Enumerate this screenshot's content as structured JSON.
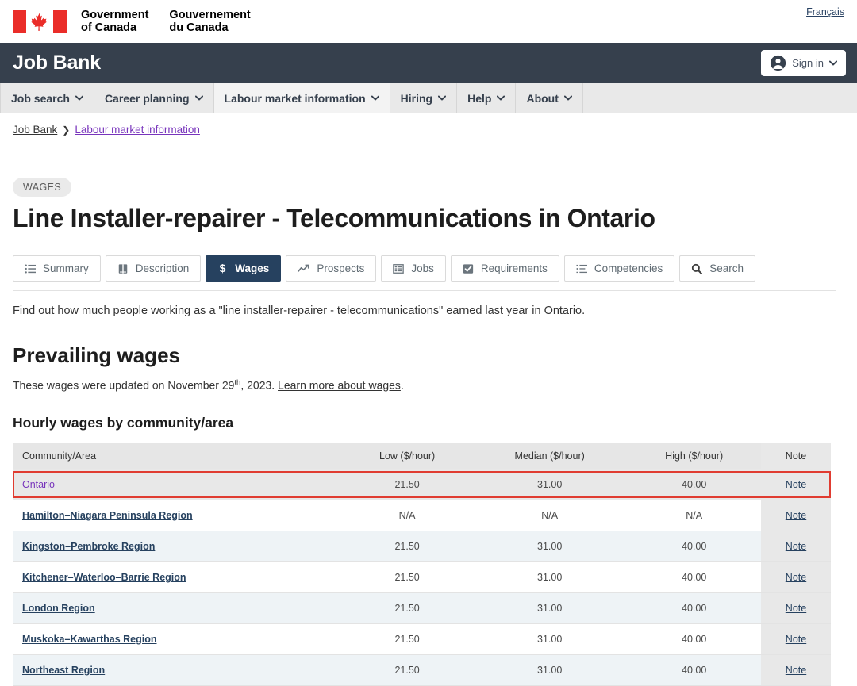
{
  "gov_band": {
    "wordmark_en_line1": "Government",
    "wordmark_en_line2": "of Canada",
    "wordmark_fr_line1": "Gouvernement",
    "wordmark_fr_line2": "du Canada",
    "language_toggle": "Français",
    "flag_icon": "canada-flag-icon"
  },
  "header": {
    "site_title": "Job Bank",
    "signin_label": "Sign in",
    "signin_icon": "user-circle-icon",
    "signin_caret_icon": "chevron-down-icon",
    "background_color": "#36404d"
  },
  "nav": {
    "items": [
      {
        "label": "Job search",
        "active": false
      },
      {
        "label": "Career planning",
        "active": false
      },
      {
        "label": "Labour market information",
        "active": true
      },
      {
        "label": "Hiring",
        "active": false
      },
      {
        "label": "Help",
        "active": false
      },
      {
        "label": "About",
        "active": false
      }
    ],
    "caret_icon": "chevron-down-icon"
  },
  "breadcrumb": {
    "home": "Job Bank",
    "separator": "❯",
    "current": "Labour market information"
  },
  "page": {
    "badge": "WAGES",
    "title": "Line Installer-repairer - Telecommunications in Ontario",
    "intro": "Find out how much people working as a \"line installer-repairer - telecommunications\" earned last year in Ontario.",
    "section_title": "Prevailing wages",
    "updated_prefix": "These wages were updated on November 29",
    "updated_suffix_sup": "th",
    "updated_rest": ", 2023. ",
    "learn_more_link": "Learn more about wages",
    "updated_period": ".",
    "table_title": "Hourly wages by community/area"
  },
  "tabs": [
    {
      "label": "Summary",
      "icon": "list-icon",
      "active": false
    },
    {
      "label": "Description",
      "icon": "book-icon",
      "active": false
    },
    {
      "label": "Wages",
      "icon": "dollar-icon",
      "active": true
    },
    {
      "label": "Prospects",
      "icon": "chart-line-icon",
      "active": false
    },
    {
      "label": "Jobs",
      "icon": "table-list-icon",
      "active": false
    },
    {
      "label": "Requirements",
      "icon": "checkbox-icon",
      "active": false
    },
    {
      "label": "Competencies",
      "icon": "ordered-list-icon",
      "active": false
    },
    {
      "label": "Search",
      "icon": "magnifier-icon",
      "active": false
    }
  ],
  "table": {
    "columns": [
      "Community/Area",
      "Low ($/hour)",
      "Median ($/hour)",
      "High ($/hour)",
      "Note"
    ],
    "note_label": "Note",
    "highlight_color": "#e03c31",
    "rows": [
      {
        "area": "Ontario",
        "low": "21.50",
        "median": "31.00",
        "high": "40.00",
        "note": "Note",
        "style": "highlight",
        "visited": true
      },
      {
        "area": "Hamilton–Niagara Peninsula Region",
        "low": "N/A",
        "median": "N/A",
        "high": "N/A",
        "note": "Note",
        "style": "plain",
        "visited": false
      },
      {
        "area": "Kingston–Pembroke Region",
        "low": "21.50",
        "median": "31.00",
        "high": "40.00",
        "note": "Note",
        "style": "alt",
        "visited": false
      },
      {
        "area": "Kitchener–Waterloo–Barrie Region",
        "low": "21.50",
        "median": "31.00",
        "high": "40.00",
        "note": "Note",
        "style": "plain",
        "visited": false
      },
      {
        "area": "London Region",
        "low": "21.50",
        "median": "31.00",
        "high": "40.00",
        "note": "Note",
        "style": "alt",
        "visited": false
      },
      {
        "area": "Muskoka–Kawarthas Region",
        "low": "21.50",
        "median": "31.00",
        "high": "40.00",
        "note": "Note",
        "style": "plain",
        "visited": false
      },
      {
        "area": "Northeast Region",
        "low": "21.50",
        "median": "31.00",
        "high": "40.00",
        "note": "Note",
        "style": "alt",
        "visited": false
      }
    ]
  }
}
